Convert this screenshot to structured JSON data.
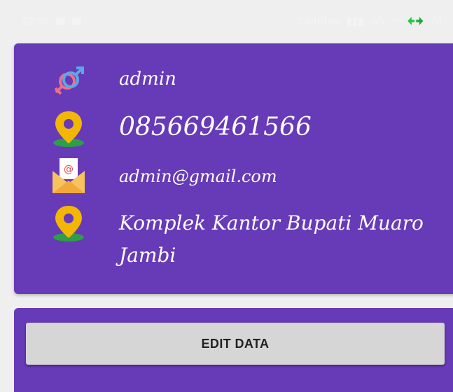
{
  "status_bar": {
    "time": "22:09",
    "network_speed": "7.54KB/s",
    "signal_text": "4G",
    "battery_level": "78"
  },
  "profile": {
    "username": "admin",
    "phone": "085669461566",
    "email": "admin@gmail.com",
    "address": "Komplek Kantor Bupati Muaro Jambi",
    "icons": {
      "gender": "gender-icon",
      "phone_location": "location-pin-icon",
      "email": "envelope-icon",
      "address": "location-pin-icon"
    }
  },
  "actions": {
    "edit_label": "EDIT DATA"
  },
  "colors": {
    "card": "#673ab7",
    "background": "#efefef",
    "button": "#d6d6d6",
    "pin": "#f2b705",
    "pin_base": "#2e9e49"
  }
}
